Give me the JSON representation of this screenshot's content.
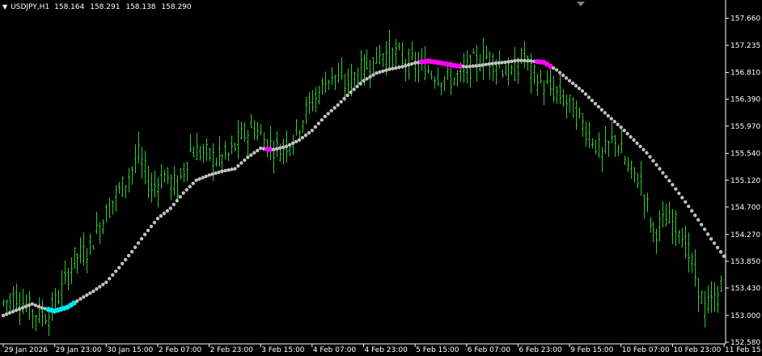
{
  "window": {
    "symbol": "USDJPY,H1",
    "ohlc": [
      "158.164",
      "158.291",
      "158.138",
      "158.290"
    ],
    "background": "#000000",
    "foreground": "#ffffff",
    "bar_color": "#32c832"
  },
  "chart_data": {
    "type": "line",
    "title": "USDJPY,H1",
    "ylim": [
      152.58,
      157.87
    ],
    "y_ticks": [
      "157.660",
      "157.235",
      "156.810",
      "156.390",
      "155.970",
      "155.540",
      "155.120",
      "154.700",
      "154.270",
      "153.850",
      "153.430",
      "153.000",
      "152.580"
    ],
    "y_tick_values": [
      157.66,
      157.235,
      156.81,
      156.39,
      155.97,
      155.54,
      155.12,
      154.7,
      154.27,
      153.85,
      153.43,
      153.0,
      152.58
    ],
    "x_ticks": [
      "29 Jan 2026",
      "29 Jan 23:00",
      "30 Jan 15:00",
      "2 Feb 07:00",
      "2 Feb 23:00",
      "3 Feb 15:00",
      "4 Feb 07:00",
      "4 Feb 23:00",
      "5 Feb 15:00",
      "6 Feb 07:00",
      "6 Feb 23:00",
      "9 Feb 15:00",
      "10 Feb 07:00",
      "10 Feb 23:00",
      "11 Feb 15"
    ],
    "x_tick_bars": [
      0,
      16,
      32,
      48,
      64,
      80,
      96,
      112,
      128,
      144,
      160,
      176,
      192,
      208,
      224
    ],
    "bars_visible": 224,
    "price_anchors": [
      [
        0,
        153.2
      ],
      [
        4,
        153.3
      ],
      [
        9,
        153.05
      ],
      [
        14,
        153.0
      ],
      [
        18,
        153.4
      ],
      [
        22,
        153.9
      ],
      [
        26,
        154.0
      ],
      [
        30,
        154.4
      ],
      [
        34,
        154.8
      ],
      [
        38,
        155.1
      ],
      [
        42,
        155.5
      ],
      [
        46,
        155.0
      ],
      [
        50,
        155.2
      ],
      [
        54,
        155.0
      ],
      [
        58,
        155.6
      ],
      [
        62,
        155.55
      ],
      [
        66,
        155.45
      ],
      [
        70,
        155.5
      ],
      [
        74,
        155.8
      ],
      [
        78,
        155.95
      ],
      [
        82,
        155.7
      ],
      [
        86,
        155.6
      ],
      [
        90,
        155.8
      ],
      [
        94,
        156.2
      ],
      [
        98,
        156.5
      ],
      [
        102,
        156.8
      ],
      [
        106,
        156.6
      ],
      [
        110,
        156.8
      ],
      [
        114,
        156.95
      ],
      [
        118,
        157.1
      ],
      [
        122,
        157.1
      ],
      [
        126,
        156.95
      ],
      [
        130,
        156.9
      ],
      [
        134,
        156.8
      ],
      [
        138,
        156.7
      ],
      [
        142,
        156.75
      ],
      [
        146,
        156.95
      ],
      [
        150,
        157.05
      ],
      [
        154,
        156.95
      ],
      [
        158,
        156.75
      ],
      [
        162,
        157.1
      ],
      [
        164,
        156.8
      ],
      [
        168,
        156.6
      ],
      [
        172,
        156.5
      ],
      [
        176,
        156.3
      ],
      [
        180,
        156.0
      ],
      [
        184,
        155.7
      ],
      [
        186,
        155.5
      ],
      [
        190,
        155.8
      ],
      [
        194,
        155.3
      ],
      [
        198,
        155.1
      ],
      [
        202,
        154.3
      ],
      [
        206,
        154.5
      ],
      [
        210,
        154.4
      ],
      [
        214,
        153.8
      ],
      [
        218,
        153.1
      ],
      [
        222,
        153.3
      ],
      [
        224,
        153.5
      ]
    ],
    "series": [
      {
        "name": "Moving Average",
        "default_color": "#c0c0c0",
        "up_color": "#00e5ee",
        "down_color": "#ff00ff",
        "anchors": [
          [
            0,
            153.0
          ],
          [
            5,
            153.1
          ],
          [
            9,
            153.18
          ],
          [
            12,
            153.12
          ],
          [
            16,
            153.07
          ],
          [
            20,
            153.13
          ],
          [
            24,
            153.26
          ],
          [
            28,
            153.38
          ],
          [
            32,
            153.52
          ],
          [
            36,
            153.75
          ],
          [
            40,
            154.0
          ],
          [
            44,
            154.27
          ],
          [
            48,
            154.52
          ],
          [
            52,
            154.68
          ],
          [
            56,
            154.92
          ],
          [
            60,
            155.12
          ],
          [
            64,
            155.2
          ],
          [
            68,
            155.26
          ],
          [
            72,
            155.3
          ],
          [
            76,
            155.48
          ],
          [
            80,
            155.62
          ],
          [
            84,
            155.6
          ],
          [
            88,
            155.65
          ],
          [
            92,
            155.75
          ],
          [
            96,
            155.9
          ],
          [
            100,
            156.12
          ],
          [
            104,
            156.3
          ],
          [
            108,
            156.5
          ],
          [
            112,
            156.68
          ],
          [
            116,
            156.8
          ],
          [
            120,
            156.86
          ],
          [
            124,
            156.9
          ],
          [
            128,
            156.96
          ],
          [
            132,
            156.99
          ],
          [
            136,
            156.96
          ],
          [
            140,
            156.92
          ],
          [
            144,
            156.9
          ],
          [
            148,
            156.92
          ],
          [
            152,
            156.95
          ],
          [
            156,
            156.97
          ],
          [
            160,
            157.0
          ],
          [
            164,
            156.99
          ],
          [
            168,
            156.97
          ],
          [
            172,
            156.85
          ],
          [
            176,
            156.68
          ],
          [
            180,
            156.52
          ],
          [
            184,
            156.32
          ],
          [
            188,
            156.13
          ],
          [
            192,
            155.95
          ],
          [
            196,
            155.75
          ],
          [
            200,
            155.55
          ],
          [
            204,
            155.3
          ],
          [
            208,
            155.05
          ],
          [
            212,
            154.78
          ],
          [
            216,
            154.5
          ],
          [
            220,
            154.2
          ],
          [
            224,
            153.93
          ]
        ],
        "colored_segments": [
          {
            "from": 14,
            "to": 22,
            "color": "#00e5ee"
          },
          {
            "from": 82,
            "to": 83,
            "color": "#ff00ff"
          },
          {
            "from": 130,
            "to": 142,
            "color": "#ff00ff"
          },
          {
            "from": 166,
            "to": 170,
            "color": "#ff00ff"
          }
        ]
      }
    ],
    "xlabel": "",
    "ylabel": "",
    "grid": false
  }
}
